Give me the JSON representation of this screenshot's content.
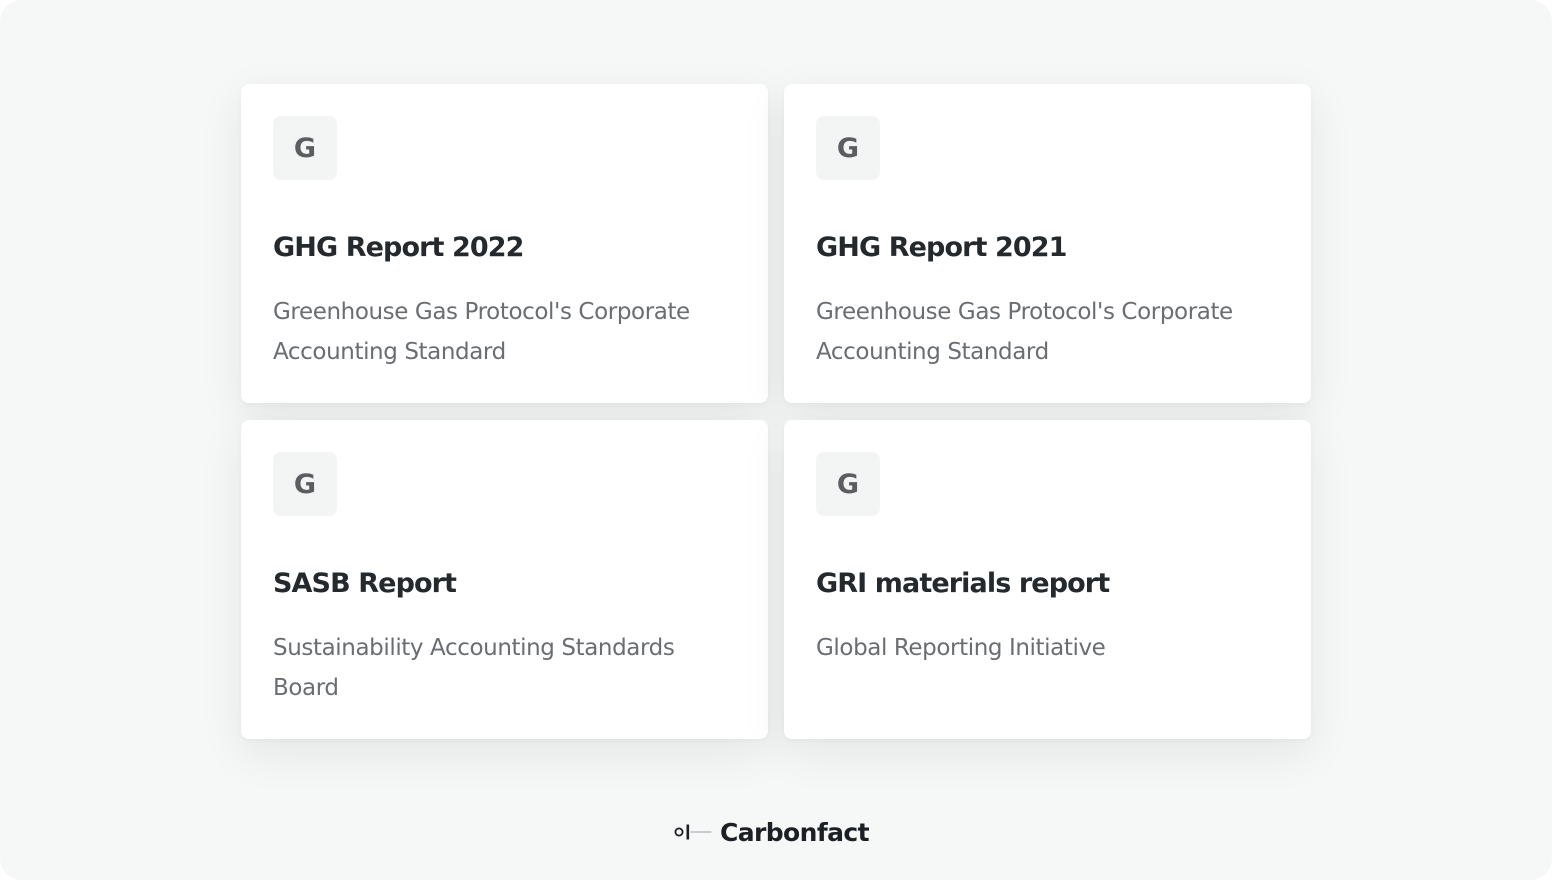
{
  "cards": [
    {
      "icon_letter": "G",
      "title": "GHG Report 2022",
      "description": "Greenhouse Gas Protocol's Corporate Accounting Standard"
    },
    {
      "icon_letter": "G",
      "title": "GHG Report 2021",
      "description": "Greenhouse Gas Protocol's Corporate Accounting Standard"
    },
    {
      "icon_letter": "G",
      "title": "SASB Report",
      "description": "Sustainability Accounting Standards Board"
    },
    {
      "icon_letter": "G",
      "title": "GRI materials report",
      "description": "Global Reporting Initiative"
    }
  ],
  "footer": {
    "brand_name": "Carbonfact",
    "brand_icon": "carbonfact-logo-icon"
  },
  "colors": {
    "background": "#f6f7f7",
    "card": "#ffffff",
    "badge": "#f3f4f4",
    "title": "#24292d",
    "description": "#6a6e72"
  }
}
